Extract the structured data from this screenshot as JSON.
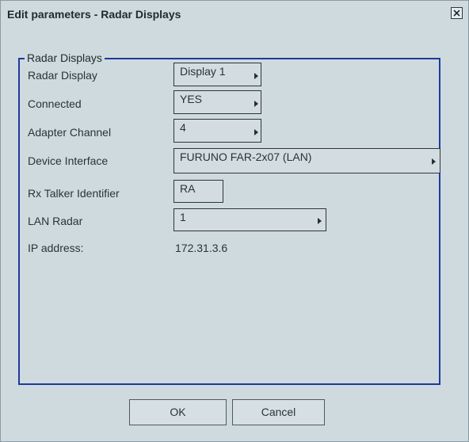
{
  "window": {
    "title": "Edit parameters - Radar Displays"
  },
  "group": {
    "legend": "Radar Displays"
  },
  "fields": {
    "radar_display": {
      "label": "Radar Display",
      "value": "Display 1"
    },
    "connected": {
      "label": "Connected",
      "value": "YES"
    },
    "adapter_channel": {
      "label": "Adapter Channel",
      "value": "4"
    },
    "device_interface": {
      "label": "Device Interface",
      "value": "FURUNO FAR-2x07 (LAN)"
    },
    "rx_talker": {
      "label": "Rx Talker Identifier",
      "value": "RA"
    },
    "lan_radar": {
      "label": "LAN Radar",
      "value": "1"
    },
    "ip_address": {
      "label": "IP address:",
      "value": "172.31.3.6"
    }
  },
  "buttons": {
    "ok": "OK",
    "cancel": "Cancel"
  },
  "icons": {
    "close": "close-icon",
    "dropdown": "chevron-right-icon"
  },
  "colors": {
    "group_border": "#1f3a99",
    "background": "#cfdadf"
  }
}
